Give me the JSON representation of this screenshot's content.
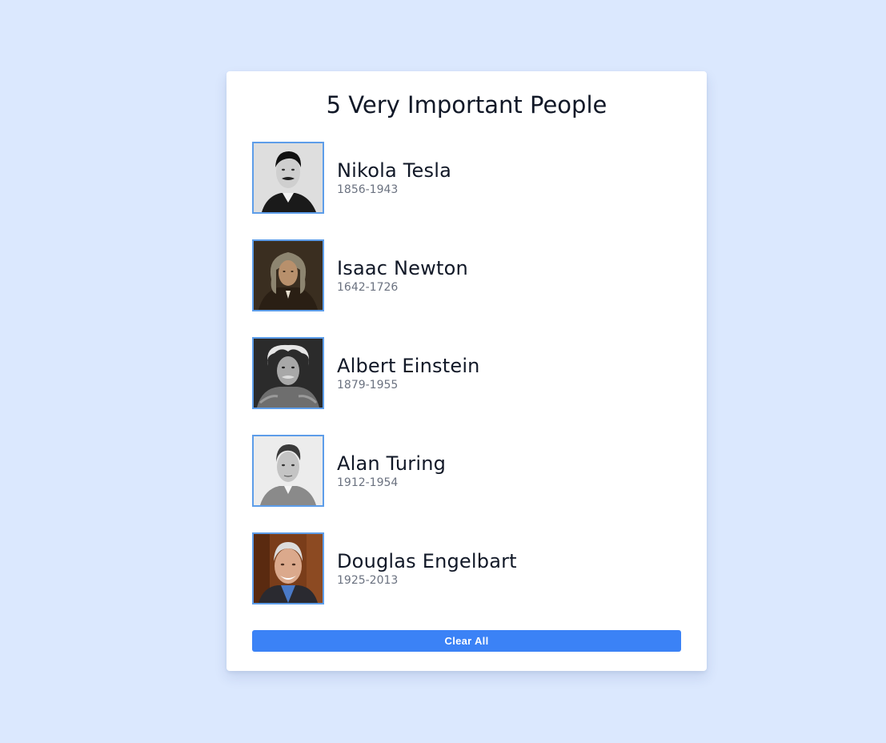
{
  "title": "5 Very Important People",
  "people": [
    {
      "name": "Nikola Tesla",
      "years": "1856-1943",
      "photo_icon": "portrait-photo"
    },
    {
      "name": "Isaac Newton",
      "years": "1642-1726",
      "photo_icon": "portrait-photo"
    },
    {
      "name": "Albert Einstein",
      "years": "1879-1955",
      "photo_icon": "portrait-photo"
    },
    {
      "name": "Alan Turing",
      "years": "1912-1954",
      "photo_icon": "portrait-photo"
    },
    {
      "name": "Douglas Engelbart",
      "years": "1925-2013",
      "photo_icon": "portrait-photo"
    }
  ],
  "clear_button_label": "Clear All",
  "colors": {
    "background": "#dbe8fe",
    "card": "#ffffff",
    "accent": "#3b82f6",
    "avatar_border": "#5d9de9",
    "name_text": "#111827",
    "years_text": "#6b7280"
  }
}
